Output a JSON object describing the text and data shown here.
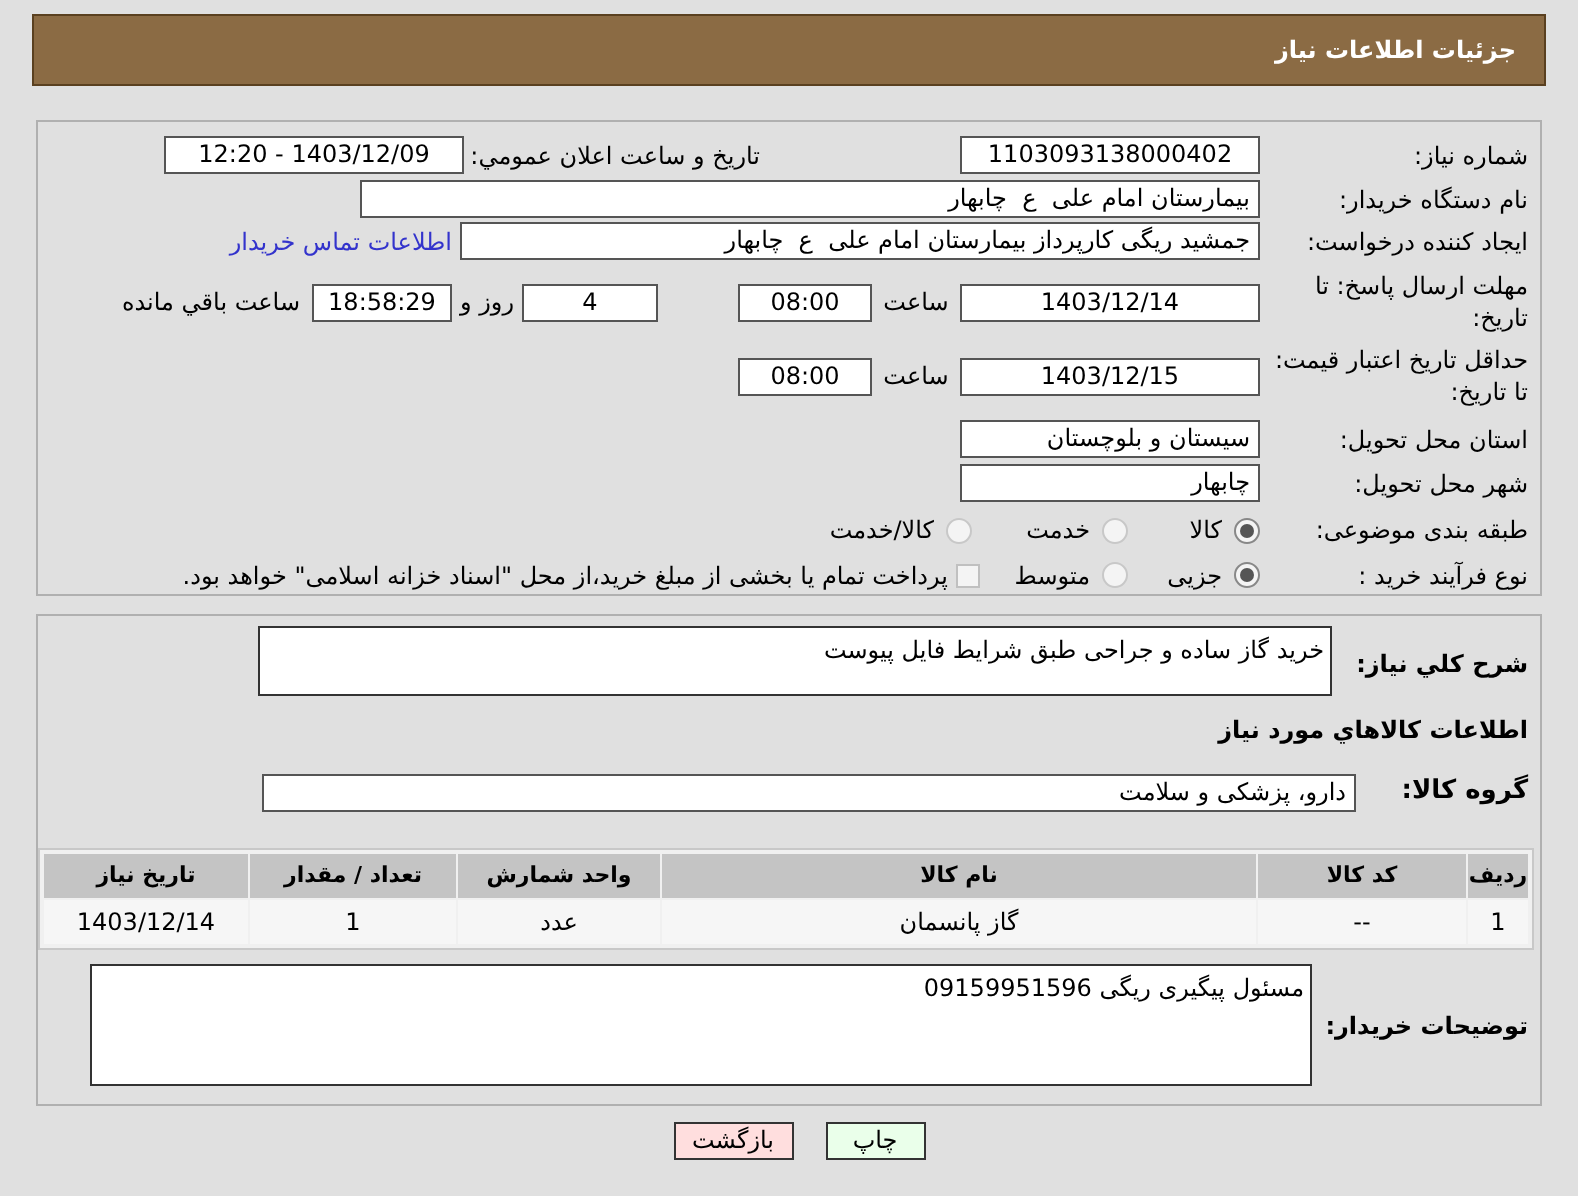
{
  "header": {
    "title": "جزئیات اطلاعات نیاز"
  },
  "need_number": {
    "label": "شماره نیاز:",
    "value": "1103093138000402"
  },
  "announce": {
    "label": "تاریخ و ساعت اعلان عمومي:",
    "value": "1403/12/09 - 12:20"
  },
  "buyer_org": {
    "label": "نام دستگاه خریدار:",
    "value": "بیمارستان امام علی  ع  چابهار"
  },
  "creator": {
    "label": "ایجاد کننده درخواست:",
    "value": "جمشید ریگی کارپرداز بیمارستان امام علی  ع  چابهار",
    "link": "اطلاعات تماس خریدار"
  },
  "reply_deadline": {
    "label": "مهلت ارسال پاسخ: تا تاریخ:",
    "date": "1403/12/14",
    "time_label": "ساعت",
    "time": "08:00",
    "days": "4",
    "days_label": "روز و",
    "remaining": "18:58:29",
    "remaining_label": "ساعت باقي مانده"
  },
  "price_validity": {
    "label": "حداقل تاریخ اعتبار قیمت: تا تاریخ:",
    "date": "1403/12/15",
    "time_label": "ساعت",
    "time": "08:00"
  },
  "province": {
    "label": "استان محل تحویل:",
    "value": "سیستان و بلوچستان"
  },
  "city": {
    "label": "شهر محل تحویل:",
    "value": "چابهار"
  },
  "category": {
    "label": "طبقه بندی موضوعی:",
    "options": [
      {
        "label": "کالا",
        "selected": true
      },
      {
        "label": "خدمت",
        "selected": false
      },
      {
        "label": "کالا/خدمت",
        "selected": false
      }
    ]
  },
  "purchase_type": {
    "label": "نوع فرآیند خرید :",
    "options": [
      {
        "label": "جزیی",
        "selected": true
      },
      {
        "label": "متوسط",
        "selected": false
      }
    ],
    "treasury": {
      "label": "پرداخت تمام یا بخشی از مبلغ خرید،از محل \"اسناد خزانه اسلامی\" خواهد بود.",
      "checked": false
    }
  },
  "description": {
    "label": "شرح کلي نیاز:",
    "value": "خرید گاز ساده و جراحی طبق شرایط فایل پیوست"
  },
  "goods_title": "اطلاعات کالاهاي مورد نیاز",
  "goods_group": {
    "label": "گروه کالا:",
    "value": "دارو، پزشکی و سلامت"
  },
  "table": {
    "columns": [
      "ردیف",
      "کد کالا",
      "نام کالا",
      "واحد شمارش",
      "تعداد / مقدار",
      "تاریخ نیاز"
    ],
    "rows": [
      [
        "1",
        "--",
        "گاز پانسمان",
        "عدد",
        "1",
        "1403/12/14"
      ]
    ]
  },
  "buyer_notes": {
    "label": "توضیحات خریدار:",
    "value": "مسئول پیگیری ریگی 09159951596"
  },
  "buttons": [
    {
      "label": "چاپ",
      "kind": "print"
    },
    {
      "label": "بازگشت",
      "kind": "back"
    }
  ]
}
